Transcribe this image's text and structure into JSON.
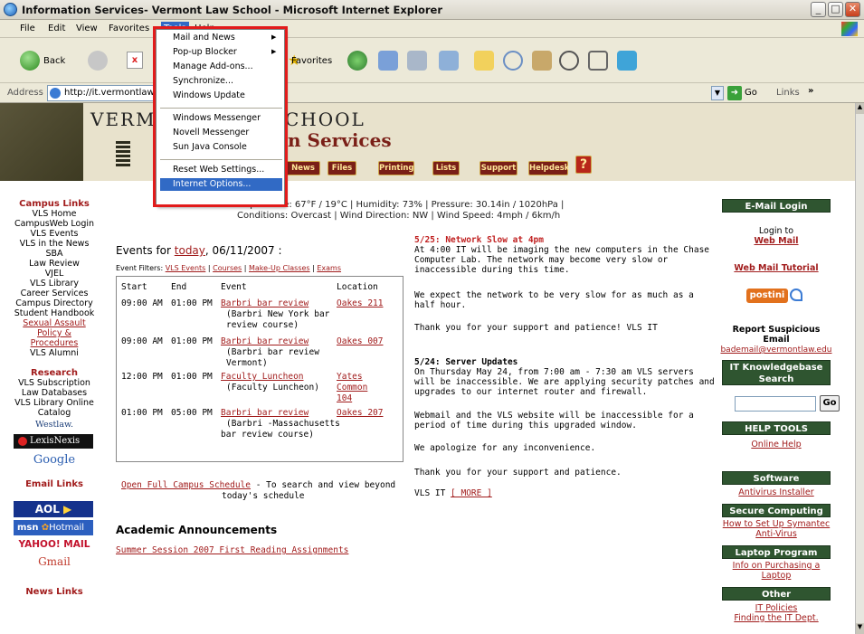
{
  "window": {
    "title": "Information Services- Vermont Law School - Microsoft Internet Explorer"
  },
  "menubar": [
    "File",
    "Edit",
    "View",
    "Favorites",
    "Tools",
    "Help"
  ],
  "toolbar": {
    "back": "Back",
    "favorites": "Favorites"
  },
  "address": {
    "label": "Address",
    "url": "http://it.vermontlaw",
    "go": "Go",
    "links": "Links"
  },
  "tools_menu": {
    "items": [
      "Mail and News",
      "Pop-up Blocker",
      "Manage Add-ons...",
      "Synchronize...",
      "Windows Update",
      "Windows Messenger",
      "Novell Messenger",
      "Sun Java Console",
      "Reset Web Settings...",
      "Internet Options..."
    ]
  },
  "banner": {
    "school": "VERM",
    "school2": "CHOOL",
    "services": "n Services",
    "nav": [
      "News",
      "Files",
      "Printing",
      "Lists",
      "Support",
      "Helpdesk",
      "?"
    ]
  },
  "weather": {
    "line1": "Temperature: 67°F / 19°C | Humidity: 73% | Pressure: 30.14in / 1020hPa |",
    "line2": "Conditions: Overcast | Wind Direction: NW | Wind Speed: 4mph / 6km/h"
  },
  "left": {
    "campus_title": "Campus Links",
    "campus": [
      "VLS Home",
      "CampusWeb Login",
      "VLS Events",
      "VLS in the News",
      "SBA",
      "Law Review",
      "VJEL",
      "VLS Library",
      "Career Services",
      "Campus Directory",
      "Student Handbook"
    ],
    "sexual": [
      "Sexual Assault",
      "Policy &",
      "Procedures"
    ],
    "alumni": "VLS Alumni",
    "research_title": "Research",
    "research": [
      "VLS Subscription",
      "Law Databases",
      "VLS Library Online",
      "Catalog"
    ],
    "westlaw": "Westlaw.",
    "lexis": "LexisNexis",
    "google": "Google",
    "email_title": "Email Links",
    "aol": "AOL",
    "msn": "msn",
    "hotmail": "Hotmail",
    "yahoo": "YAHOO! MAIL",
    "gmail": "Gmail",
    "news_title": "News Links"
  },
  "events": {
    "title_pre": "Events for ",
    "today": "today",
    "title_post": ", 06/11/2007 :",
    "filters_label": "Event Filters: ",
    "filters": [
      "VLS Events",
      "Courses",
      "Make-Up Classes",
      "Exams"
    ],
    "headers": [
      "Start",
      "End",
      "Event",
      "Location"
    ],
    "rows": [
      {
        "start": "09:00 AM",
        "end": "01:00 PM",
        "title": "Barbri bar review",
        "desc": [
          "(Barbri New York bar",
          "review course)"
        ],
        "loc": [
          "Oakes 211"
        ]
      },
      {
        "start": "09:00 AM",
        "end": "01:00 PM",
        "title": "Barbri bar review",
        "desc": [
          "(Barbri bar review",
          "Vermont)"
        ],
        "loc": [
          "Oakes 007"
        ]
      },
      {
        "start": "12:00 PM",
        "end": "01:00 PM",
        "title": "Faculty Luncheon",
        "desc": [
          "(Faculty Luncheon)"
        ],
        "loc": [
          "Yates",
          "Common",
          "104"
        ]
      },
      {
        "start": "01:00 PM",
        "end": "05:00 PM",
        "title": "Barbri bar review",
        "desc": [
          "(Barbri -Massachusetts",
          "bar review course)"
        ],
        "loc": [
          "Oakes 207"
        ]
      }
    ],
    "schedule_link": "Open Full Campus Schedule",
    "schedule_text1": " - To search and view beyond",
    "schedule_text2": "today's schedule"
  },
  "academic": {
    "title": "Academic Announcements",
    "link": "Summer Session 2007 First Reading Assignments"
  },
  "news": {
    "n1_title": "5/25: Network Slow at 4pm",
    "n1": [
      "At 4:00 IT will be imaging the new computers in the Chase",
      "Computer Lab. The network may become very slow or",
      "inaccessible during this time.",
      "",
      "We expect the network to be very slow for as much as a",
      "half hour.",
      "",
      "Thank you for your support and patience! VLS IT"
    ],
    "n2_title": "5/24: Server Updates",
    "n2": [
      "On Thursday May 24, from 7:00 am - 7:30 am VLS servers",
      "will be inaccessible. We are applying security patches and",
      "upgrades to our internet router and firewall.",
      "",
      "Webmail and the VLS website will be inaccessible for a",
      "period of time during this upgraded window.",
      "",
      "We apologize for any inconvenience.",
      "",
      "Thank you for your support and patience.",
      "",
      "VLS IT "
    ],
    "more": "[ MORE ]"
  },
  "right": {
    "email_head": "E-Mail Login",
    "login": "Login to",
    "webmail": "Web Mail",
    "tutorial": "Web Mail Tutorial",
    "postini": "postini",
    "report1": "Report Suspicious",
    "report2": "Email",
    "bademail": "bademail@vermontlaw.edu",
    "kb_head1": "IT Knowledgebase",
    "kb_head2": "Search",
    "go": "Go",
    "help_head": "HELP TOOLS",
    "online_help": "Online Help",
    "software_head": "Software",
    "antivirus": "Antivirus Installer",
    "secure_head": "Secure Computing",
    "symantec1": "How to Set Up Symantec",
    "symantec2": "Anti-Virus",
    "laptop_head": "Laptop Program",
    "laptop1": "Info on Purchasing a",
    "laptop2": "Laptop",
    "other_head": "Other",
    "policies": "IT Policies",
    "finding": "Finding the IT Dept."
  },
  "colors": {
    "accent": "#a11c1c",
    "greenhead": "#2f5530",
    "highlight": "#e21b1b"
  }
}
